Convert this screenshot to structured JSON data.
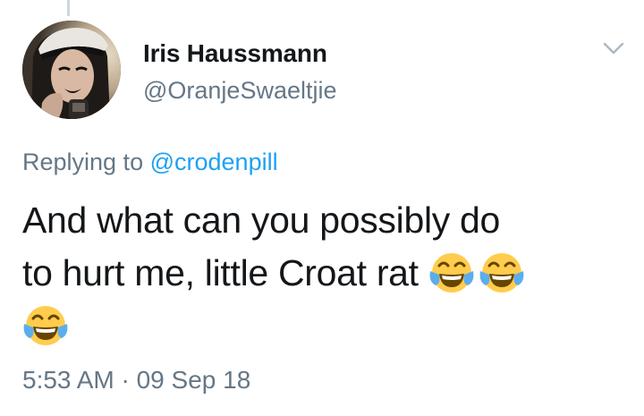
{
  "tweet": {
    "author_name": "Iris Haussmann",
    "author_handle": "@OranjeSwaeltjie",
    "reply_prefix": "Replying to",
    "reply_mention": "@crodenpill",
    "text_line_1": "And what can you possibly do",
    "text_line_2": "to hurt me, little Croat rat",
    "timestamp": "5:53 AM · 09 Sep 18",
    "trailing_emoji": [
      "face-with-tears-of-joy",
      "face-with-tears-of-joy",
      "face-with-tears-of-joy"
    ]
  },
  "colors": {
    "name": "#14171a",
    "secondary": "#657786",
    "mention": "#1da1f2",
    "thread_line": "#ccd6dd"
  },
  "icons": {
    "menu": "chevron-down-icon",
    "emoji": "face-with-tears-of-joy-icon"
  }
}
